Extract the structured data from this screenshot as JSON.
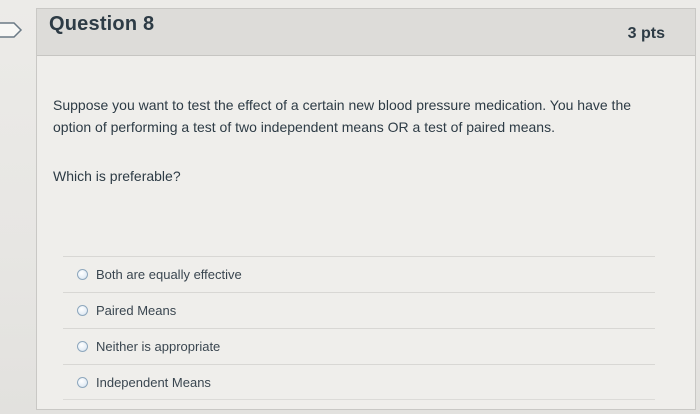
{
  "question": {
    "title": "Question 8",
    "points": "3 pts",
    "prompt": "Suppose you want to test the effect of a certain new blood pressure medication.  You have the option of performing  a test of two independent means  OR  a test of paired means.",
    "sub_prompt": "Which is preferable?",
    "answers": [
      {
        "label": "Both are equally effective"
      },
      {
        "label": "Paired Means"
      },
      {
        "label": "Neither is appropriate"
      },
      {
        "label": "Independent Means"
      }
    ]
  },
  "colors": {
    "text": "#2d3b45",
    "header_bg": "#dddcd9",
    "radio_border": "#8ea7bd"
  },
  "icons": {
    "question_flag": "bookmark-flag-icon",
    "radio": "radio-button-icon"
  }
}
